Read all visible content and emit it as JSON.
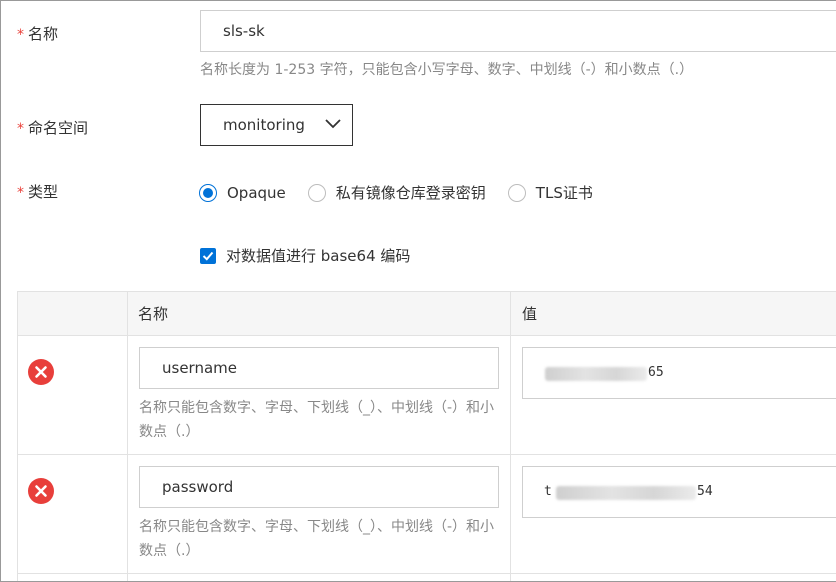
{
  "form": {
    "name": {
      "required_mark": "*",
      "label": "名称",
      "value": "sls-sk",
      "hint": "名称长度为 1-253 字符，只能包含小写字母、数字、中划线（-）和小数点（.）"
    },
    "namespace": {
      "required_mark": "*",
      "label": "命名空间",
      "selected": "monitoring",
      "icon": "chevron-down-icon"
    },
    "type": {
      "required_mark": "*",
      "label": "类型",
      "options": [
        "Opaque",
        "私有镜像仓库登录密钥",
        "TLS证书"
      ],
      "selected_index": 0
    },
    "base64": {
      "label": "对数据值进行 base64 编码",
      "checked": true
    }
  },
  "table": {
    "headers": {
      "name": "名称",
      "value": "值"
    },
    "rows": [
      {
        "name": "username",
        "value_prefix": "",
        "value_suffix": "65",
        "hint": "名称只能包含数字、字母、下划线（_）、中划线（-）和小数点（.）"
      },
      {
        "name": "password",
        "value_prefix": "t",
        "value_suffix": "54",
        "hint": "名称只能包含数字、字母、下划线（_）、中划线（-）和小数点（.）"
      }
    ]
  },
  "colors": {
    "accent": "#0072d8",
    "required": "#e9413a",
    "delete": "#e83f3b",
    "hint": "#888888"
  }
}
